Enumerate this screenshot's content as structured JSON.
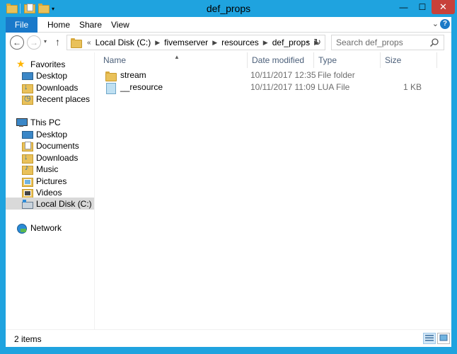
{
  "window": {
    "title": "def_props"
  },
  "titlebar": {
    "minimize": "—",
    "maximize": "☐",
    "close": "✕"
  },
  "ribbon": {
    "tabs": [
      {
        "label": "File"
      },
      {
        "label": "Home"
      },
      {
        "label": "Share"
      },
      {
        "label": "View"
      }
    ],
    "help": "?"
  },
  "navbar": {
    "back": "←",
    "forward": "→",
    "up": "↑",
    "address": {
      "lead": "«",
      "crumbs": [
        "Local Disk (C:)",
        "fivemserver",
        "resources",
        "def_props"
      ]
    },
    "search_placeholder": "Search def_props"
  },
  "navpane": {
    "favorites": {
      "label": "Favorites",
      "items": [
        {
          "label": "Desktop",
          "icon": "desktop-icon"
        },
        {
          "label": "Downloads",
          "icon": "downloads-icon"
        },
        {
          "label": "Recent places",
          "icon": "recent-places-icon"
        }
      ]
    },
    "this_pc": {
      "label": "This PC",
      "items": [
        {
          "label": "Desktop",
          "icon": "desktop-icon"
        },
        {
          "label": "Documents",
          "icon": "documents-icon"
        },
        {
          "label": "Downloads",
          "icon": "downloads-icon"
        },
        {
          "label": "Music",
          "icon": "music-icon"
        },
        {
          "label": "Pictures",
          "icon": "pictures-icon"
        },
        {
          "label": "Videos",
          "icon": "videos-icon"
        },
        {
          "label": "Local Disk (C:)",
          "icon": "local-disk-icon",
          "selected": true
        }
      ]
    },
    "network": {
      "label": "Network"
    }
  },
  "list": {
    "columns": [
      "Name",
      "Date modified",
      "Type",
      "Size"
    ],
    "rows": [
      {
        "name": "stream",
        "date": "10/11/2017 12:35",
        "type": "File folder",
        "size": "",
        "icon": "folder-icon"
      },
      {
        "name": "__resource",
        "date": "10/11/2017 11:09",
        "type": "LUA File",
        "size": "1 KB",
        "icon": "lua-file-icon"
      }
    ]
  },
  "status": {
    "items_count": "2 items"
  }
}
